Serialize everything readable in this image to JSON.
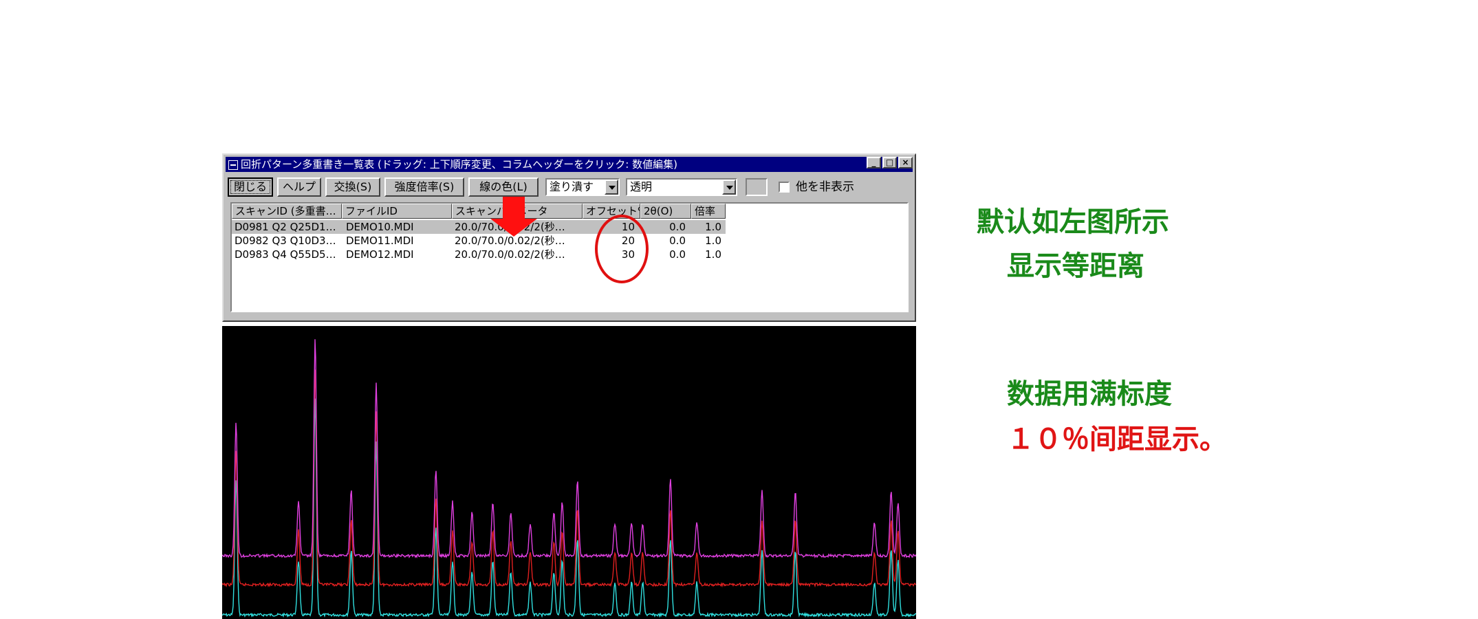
{
  "window": {
    "title": "回折パターン多重書き一覧表 (ドラッグ: 上下順序変更、コラムヘッダーをクリック: 数値編集)",
    "controls": [
      "_",
      "□",
      "×"
    ]
  },
  "toolbar": {
    "close_label": "閉じる",
    "help_label": "ヘルプ",
    "exchange_label": "交換(S)",
    "intensity_label": "強度倍率(S)",
    "linecolor_label": "線の色(L)",
    "fill_value": "塗り潰す",
    "transparency_value": "透明",
    "hide_others_label": "他を非表示"
  },
  "table": {
    "headers": [
      "スキャンID (多重書…",
      "ファイルID",
      "スキャンパラメータ",
      "オフセット%",
      "2θ(O)",
      "倍率"
    ],
    "rows": [
      [
        "D0981 Q2 Q25D1…",
        "DEMO10.MDI",
        "20.0/70.0/0.02/2(秒…",
        "10",
        "0.0",
        "1.0"
      ],
      [
        "D0982 Q3 Q10D3…",
        "DEMO11.MDI",
        "20.0/70.0/0.02/2(秒…",
        "20",
        "0.0",
        "1.0"
      ],
      [
        "D0983 Q4 Q55D5…",
        "DEMO12.MDI",
        "20.0/70.0/0.02/2(秒…",
        "30",
        "0.0",
        "1.0"
      ]
    ]
  },
  "annotations": {
    "line1": "默认如左图所示",
    "line2": "显示等距离",
    "line3": "数据用满标度",
    "line4": "１０％间距显示。"
  },
  "colors": {
    "titlebar": "#000080",
    "green_text": "#1a8a1a",
    "red_text": "#e01515",
    "series_top": "#e040e0",
    "series_mid": "#e02020",
    "series_low": "#30e0e0"
  },
  "chart_data": {
    "type": "line",
    "x_range": [
      20.0,
      70.0
    ],
    "offsets_percent": [
      10,
      20,
      30
    ],
    "peaks": [
      {
        "x": 21.0,
        "h": 0.62
      },
      {
        "x": 25.5,
        "h": 0.25
      },
      {
        "x": 26.7,
        "h": 1.0
      },
      {
        "x": 29.3,
        "h": 0.3
      },
      {
        "x": 31.1,
        "h": 0.8
      },
      {
        "x": 35.4,
        "h": 0.4
      },
      {
        "x": 36.6,
        "h": 0.25
      },
      {
        "x": 38.0,
        "h": 0.2
      },
      {
        "x": 39.5,
        "h": 0.25
      },
      {
        "x": 40.8,
        "h": 0.2
      },
      {
        "x": 42.2,
        "h": 0.15
      },
      {
        "x": 43.9,
        "h": 0.2
      },
      {
        "x": 44.5,
        "h": 0.25
      },
      {
        "x": 45.6,
        "h": 0.35
      },
      {
        "x": 48.3,
        "h": 0.15
      },
      {
        "x": 49.5,
        "h": 0.15
      },
      {
        "x": 50.3,
        "h": 0.15
      },
      {
        "x": 52.3,
        "h": 0.35
      },
      {
        "x": 54.2,
        "h": 0.15
      },
      {
        "x": 58.9,
        "h": 0.3
      },
      {
        "x": 61.3,
        "h": 0.3
      },
      {
        "x": 67.0,
        "h": 0.15
      },
      {
        "x": 68.2,
        "h": 0.3
      },
      {
        "x": 68.7,
        "h": 0.25
      }
    ]
  }
}
